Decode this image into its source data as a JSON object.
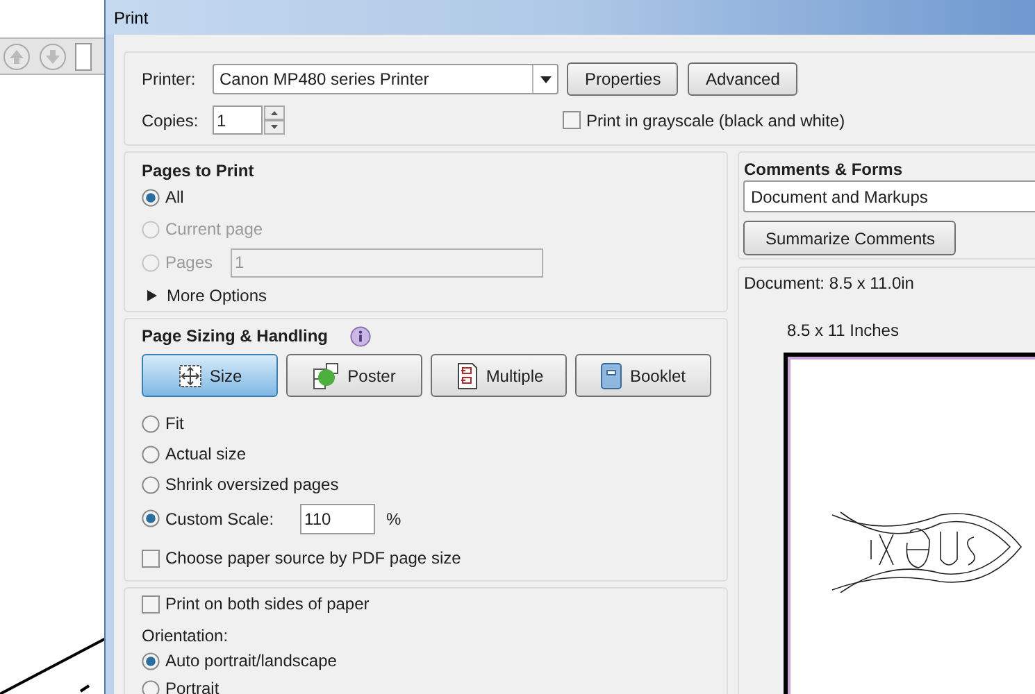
{
  "window": {
    "title": "Print"
  },
  "printer": {
    "label": "Printer:",
    "value": "Canon MP480 series Printer"
  },
  "buttons": [
    "Properties",
    "Advanced"
  ],
  "copies": {
    "label": "Copies:",
    "value": "1"
  },
  "grayscale": {
    "label": "Print in grayscale (black and white)",
    "checked": false
  },
  "pages_to_print": {
    "title": "Pages to Print",
    "options": [
      {
        "label": "All",
        "selected": true,
        "disabled": false
      },
      {
        "label": "Current page",
        "selected": false,
        "disabled": true
      },
      {
        "label": "Pages",
        "selected": false,
        "disabled": true,
        "value": "1"
      }
    ],
    "more_options": {
      "label": "More Options",
      "expanded": false
    }
  },
  "page_sizing": {
    "title": "Page Sizing & Handling",
    "modes": [
      {
        "kind": "size",
        "label": "Size",
        "selected": true
      },
      {
        "kind": "poster",
        "label": "Poster",
        "selected": false
      },
      {
        "kind": "multiple",
        "label": "Multiple",
        "selected": false
      },
      {
        "kind": "booklet",
        "label": "Booklet",
        "selected": false
      }
    ],
    "scale_options": [
      {
        "label": "Fit",
        "selected": false
      },
      {
        "label": "Actual size",
        "selected": false
      },
      {
        "label": "Shrink oversized pages",
        "selected": false
      },
      {
        "label": "Custom Scale:",
        "selected": true,
        "value": "110",
        "unit": "%"
      }
    ],
    "paper_source": {
      "label": "Choose paper source by PDF page size",
      "checked": false
    }
  },
  "duplex": {
    "label": "Print on both sides of paper",
    "checked": false
  },
  "orientation": {
    "label": "Orientation:",
    "options": [
      {
        "label": "Auto portrait/landscape",
        "selected": true
      },
      {
        "label": "Portrait",
        "selected": false
      }
    ]
  },
  "comments_forms": {
    "title": "Comments & Forms",
    "value": "Document and Markups",
    "button": "Summarize Comments"
  },
  "preview": {
    "document_size": "Document: 8.5 x 11.0in",
    "paper_size": "8.5 x 11 Inches"
  }
}
